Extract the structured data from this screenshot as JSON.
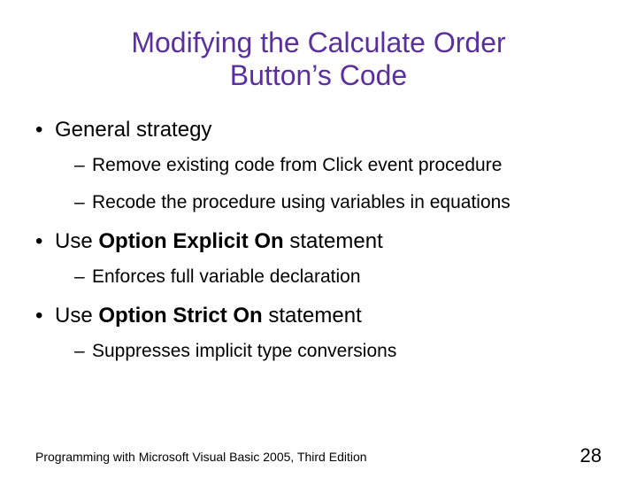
{
  "title_line1": "Modifying the Calculate Order",
  "title_line2": "Button’s Code",
  "bullets": {
    "b1": {
      "text": "General strategy",
      "sub": {
        "s1": "Remove existing code from Click event procedure",
        "s2": "Recode the procedure using variables in equations"
      }
    },
    "b2": {
      "pre": "Use ",
      "bold": "Option Explicit On",
      "post": " statement",
      "sub": {
        "s1": "Enforces full variable declaration"
      }
    },
    "b3": {
      "pre": "Use ",
      "bold": "Option Strict On",
      "post": " statement",
      "sub": {
        "s1": "Suppresses implicit type conversions"
      }
    }
  },
  "footer": "Programming with Microsoft Visual Basic 2005, Third Edition",
  "page_number": "28",
  "glyphs": {
    "dot": "•",
    "dash": "–"
  }
}
